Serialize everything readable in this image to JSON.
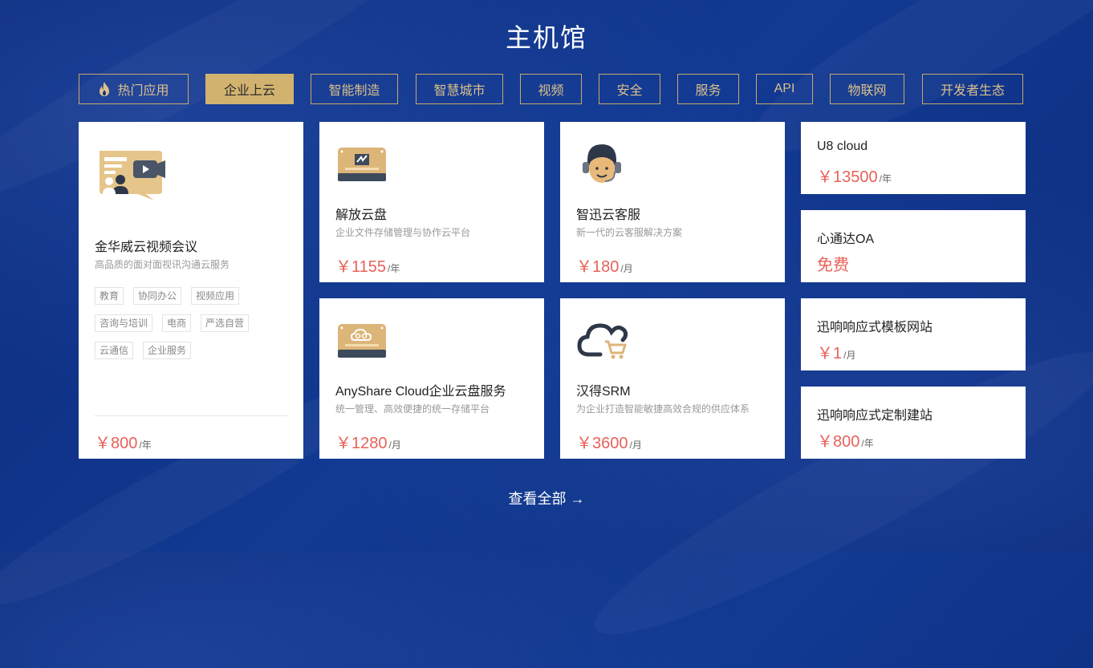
{
  "title": "主机馆",
  "tabs": [
    {
      "label": "热门应用",
      "icon": "flame-icon"
    },
    {
      "label": "企业上云",
      "active": true
    },
    {
      "label": "智能制造"
    },
    {
      "label": "智慧城市"
    },
    {
      "label": "视频"
    },
    {
      "label": "安全"
    },
    {
      "label": "服务"
    },
    {
      "label": "API"
    },
    {
      "label": "物联网"
    },
    {
      "label": "开发者生态"
    }
  ],
  "featured": {
    "name": "金华威云视频会议",
    "desc": "高品质的面对面视讯沟通云服务",
    "tags": [
      "教育",
      "协同办公",
      "视频应用",
      "咨询与培训",
      "电商",
      "严选自营",
      "云通信",
      "企业服务"
    ],
    "price": "￥800",
    "unit": "/年",
    "icon": "video-conference-icon"
  },
  "cards": [
    {
      "name": "解放云盘",
      "desc": "企业文件存储管理与协作云平台",
      "price": "￥1155",
      "unit": "/年",
      "icon": "cloud-disk-icon"
    },
    {
      "name": "智迅云客服",
      "desc": "新一代的云客服解决方案",
      "price": "￥180",
      "unit": "/月",
      "icon": "customer-service-icon"
    },
    {
      "name": "AnyShare Cloud企业云盘服务",
      "desc": "统一管理、高效便捷的统一存储平台",
      "price": "￥1280",
      "unit": "/月",
      "icon": "cloud-storage-icon"
    },
    {
      "name": "汉得SRM",
      "desc": "为企业打造智能敏捷高效合规的供应体系",
      "price": "￥3600",
      "unit": "/月",
      "icon": "cloud-cart-icon"
    }
  ],
  "side_cards": [
    {
      "name": "U8 cloud",
      "price": "￥13500",
      "unit": "/年"
    },
    {
      "name": "心通达OA",
      "free": "免费"
    },
    {
      "name": "迅响响应式模板网站",
      "price": "￥1",
      "unit": "/月"
    },
    {
      "name": "迅响响应式定制建站",
      "price": "￥800",
      "unit": "/年"
    }
  ],
  "view_all": "查看全部 →",
  "colors": {
    "background": "#0d2c7f",
    "gold": "#d2b26f",
    "price": "#e8615a"
  }
}
